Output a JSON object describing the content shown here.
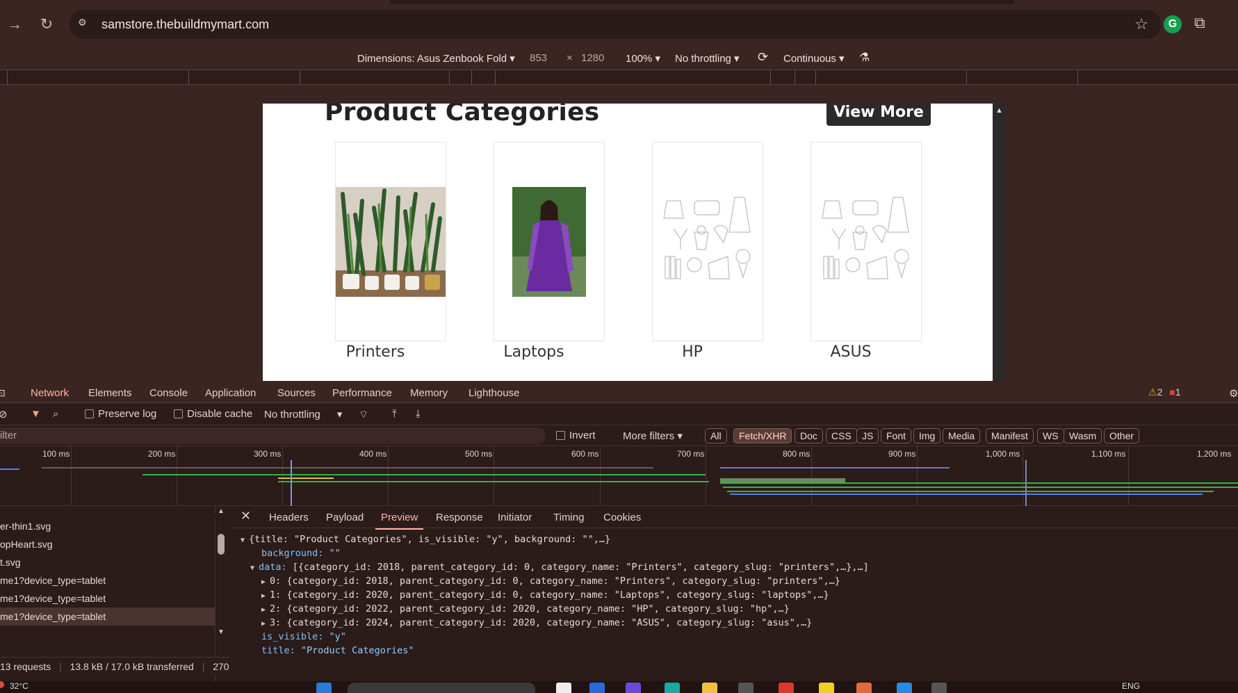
{
  "browser": {
    "url": "samstore.thebuildmymart.com",
    "forward_icon": "forward-arrow-icon",
    "reload_icon": "reload-icon",
    "star_icon": "bookmark-star-icon",
    "extension_badge": "G"
  },
  "device_toolbar": {
    "dimensions_label": "Dimensions: Asus Zenbook Fold",
    "width": "853",
    "times": "×",
    "height": "1280",
    "zoom": "100%",
    "throttling": "No throttling",
    "mode": "Continuous"
  },
  "page": {
    "section_title": "Product Categories",
    "view_more": "View More",
    "categories": [
      {
        "label": "Printers",
        "image": "plants-photo"
      },
      {
        "label": "Laptops",
        "image": "purple-dress-photo"
      },
      {
        "label": "HP",
        "image": "placeholder-sketch"
      },
      {
        "label": "ASUS",
        "image": "placeholder-sketch"
      }
    ]
  },
  "devtools": {
    "tabs": [
      "Network",
      "Elements",
      "Console",
      "Application",
      "Sources",
      "Performance",
      "Memory",
      "Lighthouse"
    ],
    "active_tab": "Network",
    "warnings": "2",
    "errors": "1",
    "toolbar": {
      "preserve_log": "Preserve log",
      "disable_cache": "Disable cache",
      "throttling": "No throttling"
    },
    "filter": {
      "placeholder": "ilter",
      "invert": "Invert",
      "more_filters": "More filters",
      "chips": [
        "All",
        "Fetch/XHR",
        "Doc",
        "CSS",
        "JS",
        "Font",
        "Img",
        "Media",
        "Manifest",
        "WS",
        "Wasm",
        "Other"
      ],
      "active_chip": "Fetch/XHR"
    },
    "timeline_labels": [
      "100 ms",
      "200 ms",
      "300 ms",
      "400 ms",
      "500 ms",
      "600 ms",
      "700 ms",
      "800 ms",
      "900 ms",
      "1,000 ms",
      "1,100 ms",
      "1,200 ms"
    ],
    "requests": [
      "er-thin1.svg",
      "opHeart.svg",
      "t.svg",
      "me1?device_type=tablet",
      "me1?device_type=tablet",
      "me1?device_type=tablet"
    ],
    "summary": {
      "requests": "13 requests",
      "transferred": "13.8 kB / 17.0 kB transferred",
      "extra": "270"
    },
    "detail_tabs": [
      "Headers",
      "Payload",
      "Preview",
      "Response",
      "Initiator",
      "Timing",
      "Cookies"
    ],
    "active_detail_tab": "Preview",
    "preview": {
      "root": "{title: \"Product Categories\", is_visible: \"y\", background: \"\",…}",
      "background_key": "background:",
      "background_val": "\"\"",
      "data_key": "data:",
      "data_summary": "[{category_id: 2018, parent_category_id: 0, category_name: \"Printers\", category_slug: \"printers\",…},…]",
      "items": [
        "0: {category_id: 2018, parent_category_id: 0, category_name: \"Printers\", category_slug: \"printers\",…}",
        "1: {category_id: 2020, parent_category_id: 0, category_name: \"Laptops\", category_slug: \"laptops\",…}",
        "2: {category_id: 2022, parent_category_id: 2020, category_name: \"HP\", category_slug: \"hp\",…}",
        "3: {category_id: 2024, parent_category_id: 2020, category_name: \"ASUS\", category_slug: \"asus\",…}"
      ],
      "is_visible_key": "is_visible:",
      "is_visible_val": "\"y\"",
      "title_key": "title:",
      "title_val": "\"Product Categories\""
    }
  },
  "taskbar": {
    "temperature": "32°C",
    "language": "ENG"
  }
}
